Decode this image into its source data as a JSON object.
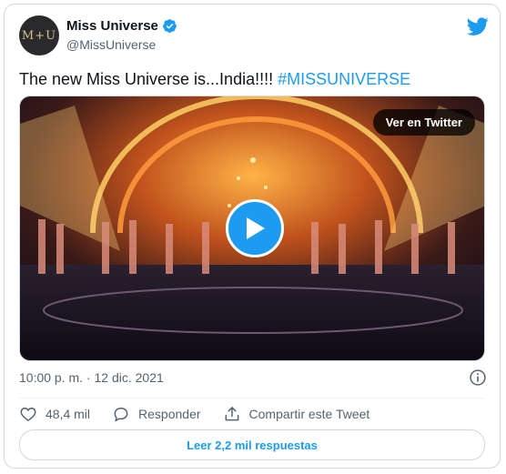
{
  "author": {
    "avatar_text": "M+U",
    "display_name": "Miss Universe",
    "handle": "@MissUniverse"
  },
  "tweet": {
    "text": "The new Miss Universe is...India!!!! ",
    "hashtag": "#MISSUNIVERSE"
  },
  "media": {
    "view_on_twitter_label": "Ver en Twitter"
  },
  "meta": {
    "timestamp": "10:00 p. m. · 12 dic. 2021"
  },
  "actions": {
    "likes": "48,4 mil",
    "reply_label": "Responder",
    "share_label": "Compartir este Tweet"
  },
  "footer": {
    "read_replies_label": "Leer 2,2 mil respuestas"
  },
  "colors": {
    "accent": "#1d9bf0",
    "text": "#0f1419",
    "secondary": "#536471"
  }
}
